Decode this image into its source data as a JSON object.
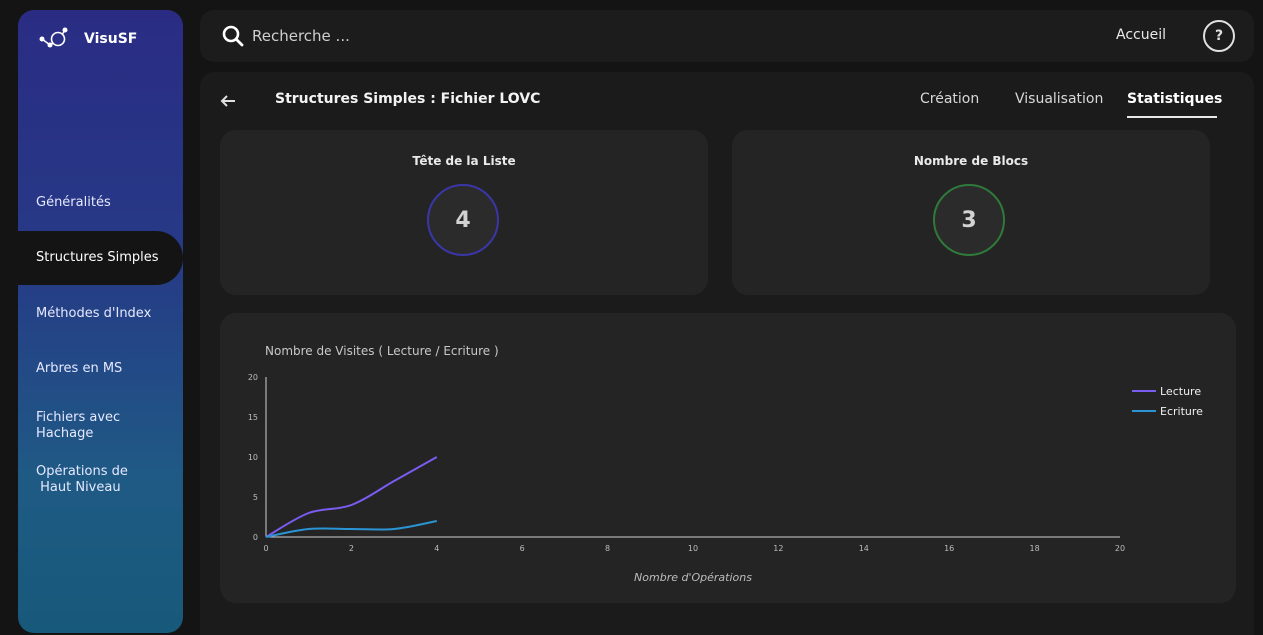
{
  "app": {
    "name": "VisuSF"
  },
  "sidebar": {
    "items": [
      {
        "label": "Généralités"
      },
      {
        "label": "Structures Simples"
      },
      {
        "label": "Méthodes d'Index"
      },
      {
        "label": "Arbres en MS"
      },
      {
        "label": "Fichiers avec",
        "label2": "Hachage"
      },
      {
        "label": "Opérations de",
        "label2": " Haut Niveau"
      }
    ]
  },
  "header": {
    "search_placeholder": "Recherche ...",
    "home": "Accueil",
    "help": "?"
  },
  "page": {
    "title": "Structures Simples : Fichier LOVC",
    "tabs": [
      {
        "label": "Création"
      },
      {
        "label": "Visualisation"
      },
      {
        "label": "Statistiques"
      }
    ],
    "active_tab": "Statistiques"
  },
  "stats": {
    "head": {
      "title": "Tête de la Liste",
      "value": "4",
      "color": "#3b36a8"
    },
    "blocks": {
      "title": "Nombre de Blocs",
      "value": "3",
      "color": "#2f7a3a"
    }
  },
  "chart_data": {
    "type": "line",
    "title": "Nombre de Visites ( Lecture / Ecriture )",
    "xlabel": "Nombre d'Opérations",
    "ylabel": "",
    "xlim": [
      0,
      20
    ],
    "ylim": [
      0,
      20
    ],
    "xticks": [
      0,
      2,
      4,
      6,
      8,
      10,
      12,
      14,
      16,
      18,
      20
    ],
    "yticks": [
      0,
      5,
      10,
      15,
      20
    ],
    "x": [
      0,
      1,
      2,
      3,
      4
    ],
    "series": [
      {
        "name": "Lecture",
        "color": "#7b5cf0",
        "values": [
          0,
          3,
          4,
          7,
          10
        ]
      },
      {
        "name": "Ecriture",
        "color": "#2a94d4",
        "values": [
          0,
          1,
          1,
          1,
          2
        ]
      }
    ],
    "legend": "top-right",
    "grid": false
  }
}
